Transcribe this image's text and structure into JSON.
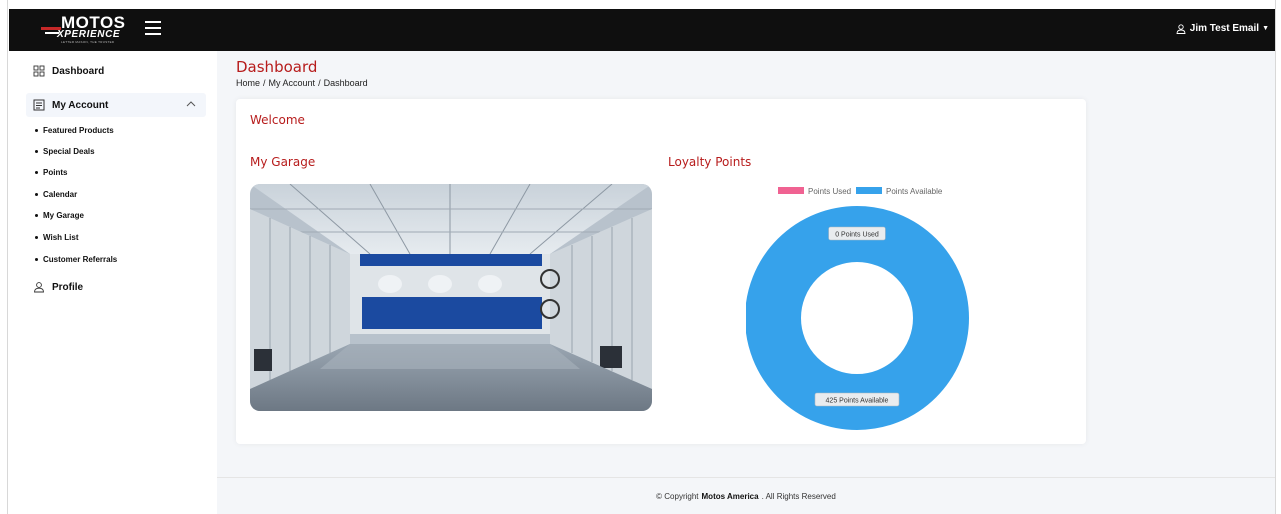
{
  "header": {
    "logo_top": "MOTOS",
    "logo_bottom": "XPERIENCE",
    "logo_tagline": "LETTER MASON, THE TRUSTED",
    "user_name": "Jim Test Email"
  },
  "sidebar": {
    "dashboard": "Dashboard",
    "my_account": "My Account",
    "sub_items": [
      "Featured Products",
      "Special Deals",
      "Points",
      "Calendar",
      "My Garage",
      "Wish List",
      "Customer Referrals"
    ],
    "profile": "Profile"
  },
  "page": {
    "title": "Dashboard",
    "breadcrumb": [
      "Home",
      "/",
      "My Account",
      "/",
      "Dashboard"
    ]
  },
  "card": {
    "welcome": "Welcome",
    "garage_title": "My Garage",
    "loyalty_title": "Loyalty Points"
  },
  "chart_data": {
    "type": "pie",
    "donut": true,
    "categories": [
      "Points Used",
      "Points Available"
    ],
    "values": [
      0,
      425
    ],
    "colors": [
      "#f06292",
      "#36a2eb"
    ],
    "slice_labels": [
      "0 Points Used",
      "425 Points Available"
    ],
    "legend_position": "top"
  },
  "footer": {
    "prefix": "© Copyright",
    "brand": "Motos America",
    "suffix": ". All Rights Reserved"
  },
  "colors": {
    "accent": "#b71c1c",
    "topbar": "#0f0f0f",
    "used": "#f06292",
    "available": "#36a2eb"
  }
}
